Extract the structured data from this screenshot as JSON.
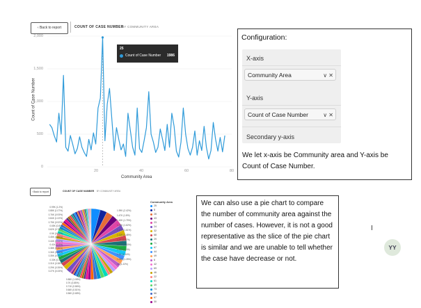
{
  "top_chart": {
    "back_label": "Back to report",
    "title": "COUNT OF CASE NUMBER",
    "subtitle": "BY COMMUNITY AREA",
    "y_ticks": [
      "2,000",
      "1,500",
      "1,000",
      "500",
      "0"
    ],
    "x_ticks": [
      "20",
      "40",
      "60",
      "80"
    ],
    "ylabel": "Count of Case Number",
    "xlabel": "Community Area",
    "tooltip": {
      "x": "25",
      "series": "Count of Case Number",
      "value": "1986"
    }
  },
  "chart_data": {
    "type": "line",
    "x": [
      1,
      2,
      3,
      4,
      5,
      6,
      7,
      8,
      9,
      10,
      11,
      12,
      13,
      14,
      15,
      16,
      17,
      18,
      19,
      20,
      21,
      22,
      23,
      24,
      25,
      26,
      27,
      28,
      29,
      30,
      31,
      32,
      33,
      34,
      35,
      36,
      37,
      38,
      39,
      40,
      41,
      42,
      43,
      44,
      45,
      46,
      47,
      48,
      49,
      50,
      51,
      52,
      53,
      54,
      55,
      56,
      57,
      58,
      59,
      60,
      61,
      62,
      63,
      64,
      65,
      66,
      67,
      68,
      69,
      70,
      71,
      72,
      73,
      74,
      75,
      76,
      77
    ],
    "values": [
      650,
      600,
      480,
      380,
      820,
      500,
      1400,
      300,
      240,
      480,
      350,
      200,
      280,
      460,
      300,
      220,
      160,
      420,
      260,
      520,
      350,
      900,
      1050,
      1980,
      400,
      960,
      1200,
      720,
      250,
      600,
      420,
      260,
      350,
      160,
      820,
      560,
      300,
      180,
      900,
      280,
      220,
      400,
      600,
      1150,
      500,
      380,
      220,
      300,
      580,
      420,
      250,
      650,
      300,
      820,
      620,
      240,
      150,
      380,
      900,
      500,
      280,
      180,
      300,
      550,
      180,
      400,
      250,
      620,
      300,
      120,
      250,
      680,
      420,
      240,
      450,
      230,
      480
    ],
    "ylim": [
      0,
      2000
    ],
    "xlim": [
      0,
      80
    ],
    "xlabel": "Community Area",
    "ylabel": "Count of Case Number",
    "title": "COUNT OF CASE NUMBER"
  },
  "config": {
    "title": "Configuration:",
    "x_axis_label": "X-axis",
    "x_axis_field": "Community Area",
    "y_axis_label": "Y-axis",
    "y_axis_field": "Count of Case Number",
    "secondary_label": "Secondary y-axis",
    "field_icons": "∨ ✕",
    "note": "We let x-axis be Community area and Y-axis be Count of Case Number."
  },
  "pie_chart": {
    "back_label": "Back to report",
    "title": "COUNT OF CASE NUMBER",
    "subtitle": "BY COMMUNITY AREA",
    "legend_title": "Community Area",
    "legend": [
      {
        "label": "25",
        "color": "#118dff"
      },
      {
        "label": "8",
        "color": "#12239e"
      },
      {
        "label": "28",
        "color": "#e66c37"
      },
      {
        "label": "43",
        "color": "#6b007b"
      },
      {
        "label": "23",
        "color": "#e044a7"
      },
      {
        "label": "24",
        "color": "#744ec2"
      },
      {
        "label": "32",
        "color": "#d9b300"
      },
      {
        "label": "68",
        "color": "#d64550"
      },
      {
        "label": "29",
        "color": "#197278"
      },
      {
        "label": "71",
        "color": "#1aab40"
      },
      {
        "label": "67",
        "color": "#15c6f4"
      },
      {
        "label": "44",
        "color": "#4092ff"
      },
      {
        "label": "49",
        "color": "#ffa058"
      },
      {
        "label": "6",
        "color": "#be5dc9"
      },
      {
        "label": "42",
        "color": "#f472d0"
      },
      {
        "label": "69",
        "color": "#b5a1ff"
      },
      {
        "label": "46",
        "color": "#c4a200"
      },
      {
        "label": "22",
        "color": "#ff8080"
      },
      {
        "label": "61",
        "color": "#00dbbc"
      },
      {
        "label": "49",
        "color": "#5bd667"
      },
      {
        "label": "73",
        "color": "#0091d5"
      },
      {
        "label": "66",
        "color": "#4668c5"
      },
      {
        "label": "67",
        "color": "#ff6300"
      },
      {
        "label": "30",
        "color": "#99008a"
      }
    ],
    "left_labels": [
      "0.99K (1.2%)",
      "0.88K (1.07%)",
      "0.76K (0.93%)",
      "0.84K (1.02%)",
      "0.75K (0.92%)",
      "0.65K (0.8%)",
      "0.62K (0.76%)",
      "0.5K (0.61%)",
      "0.45K (0.55%)",
      "0.44K (0.54%)",
      "0.41K (0.5%)",
      "0.38K (0.46%)",
      "0.36K (0.44%)",
      "0.35K (0.43%)",
      "0.33K (0.4%)",
      "0.31K (0.38%)",
      "0.29K (0.35%)",
      "0.27K (0.33%)"
    ],
    "right_labels": [
      "1.99K (2.42%)",
      "1.47K (1.8%)",
      "1.43K (1.75%)",
      "1.33K (1.62%)",
      "1.32K (1.61%)",
      "1.21K (1.48%)",
      "1.2K (1.47%)",
      "1.17K (1.43%)",
      "1.15K (1.4%)",
      "1.1K (1.34%)",
      "1.05K (1.28%)",
      "1K (1.22%)"
    ],
    "bottom_labels": [
      "0.88K (1.08%)",
      "0.7K (0.85%)",
      "0.71K (0.86%)",
      "0.66K (0.81%)",
      "0.56K (0.68%)"
    ],
    "slice_colors": [
      "#118dff",
      "#12239e",
      "#e66c37",
      "#6b007b",
      "#e044a7",
      "#744ec2",
      "#d9b300",
      "#d64550",
      "#197278",
      "#1aab40",
      "#15c6f4",
      "#4092ff",
      "#ffa058",
      "#be5dc9",
      "#f472d0",
      "#b5a1ff",
      "#c4a200",
      "#ff8080",
      "#00dbbc",
      "#5bd667",
      "#0091d5",
      "#4668c5",
      "#ff6300",
      "#99008a",
      "#ec008c",
      "#533285",
      "#99700a",
      "#ff4141",
      "#1f9a85",
      "#255a91"
    ],
    "slice_values": [
      2.42,
      1.8,
      1.75,
      1.62,
      1.61,
      1.48,
      1.47,
      1.43,
      1.4,
      1.34,
      1.28,
      1.22,
      1.2,
      1.08,
      0.86,
      0.85,
      0.81,
      0.68,
      1.07,
      0.93,
      1.02,
      0.92,
      0.8,
      0.76,
      0.61,
      0.55,
      0.54,
      0.5,
      0.46,
      0.44,
      0.43,
      0.4,
      0.38,
      0.35,
      0.33,
      1.2,
      1.1,
      1.0,
      0.95,
      0.9,
      0.88,
      0.85,
      0.82,
      0.8,
      0.78,
      0.75,
      0.72,
      0.7,
      0.68,
      0.66,
      0.64,
      0.62,
      0.6,
      0.58,
      0.56,
      0.54,
      0.52,
      0.5,
      0.48,
      0.46,
      0.44,
      0.42,
      0.4,
      0.38,
      0.36,
      0.34,
      0.32,
      0.3,
      0.28,
      0.26,
      0.24,
      0.22,
      0.2,
      0.18,
      0.16,
      0.14,
      0.12
    ]
  },
  "note": {
    "text": "We can also use a pie chart to compare the number of community area against the number of cases. However, it is not a good representative as the slice of the pie chart is similar and we are unable to tell whether the case have decrease or not."
  },
  "avatar": {
    "initials": "YY"
  },
  "cursor_glyph": "I"
}
